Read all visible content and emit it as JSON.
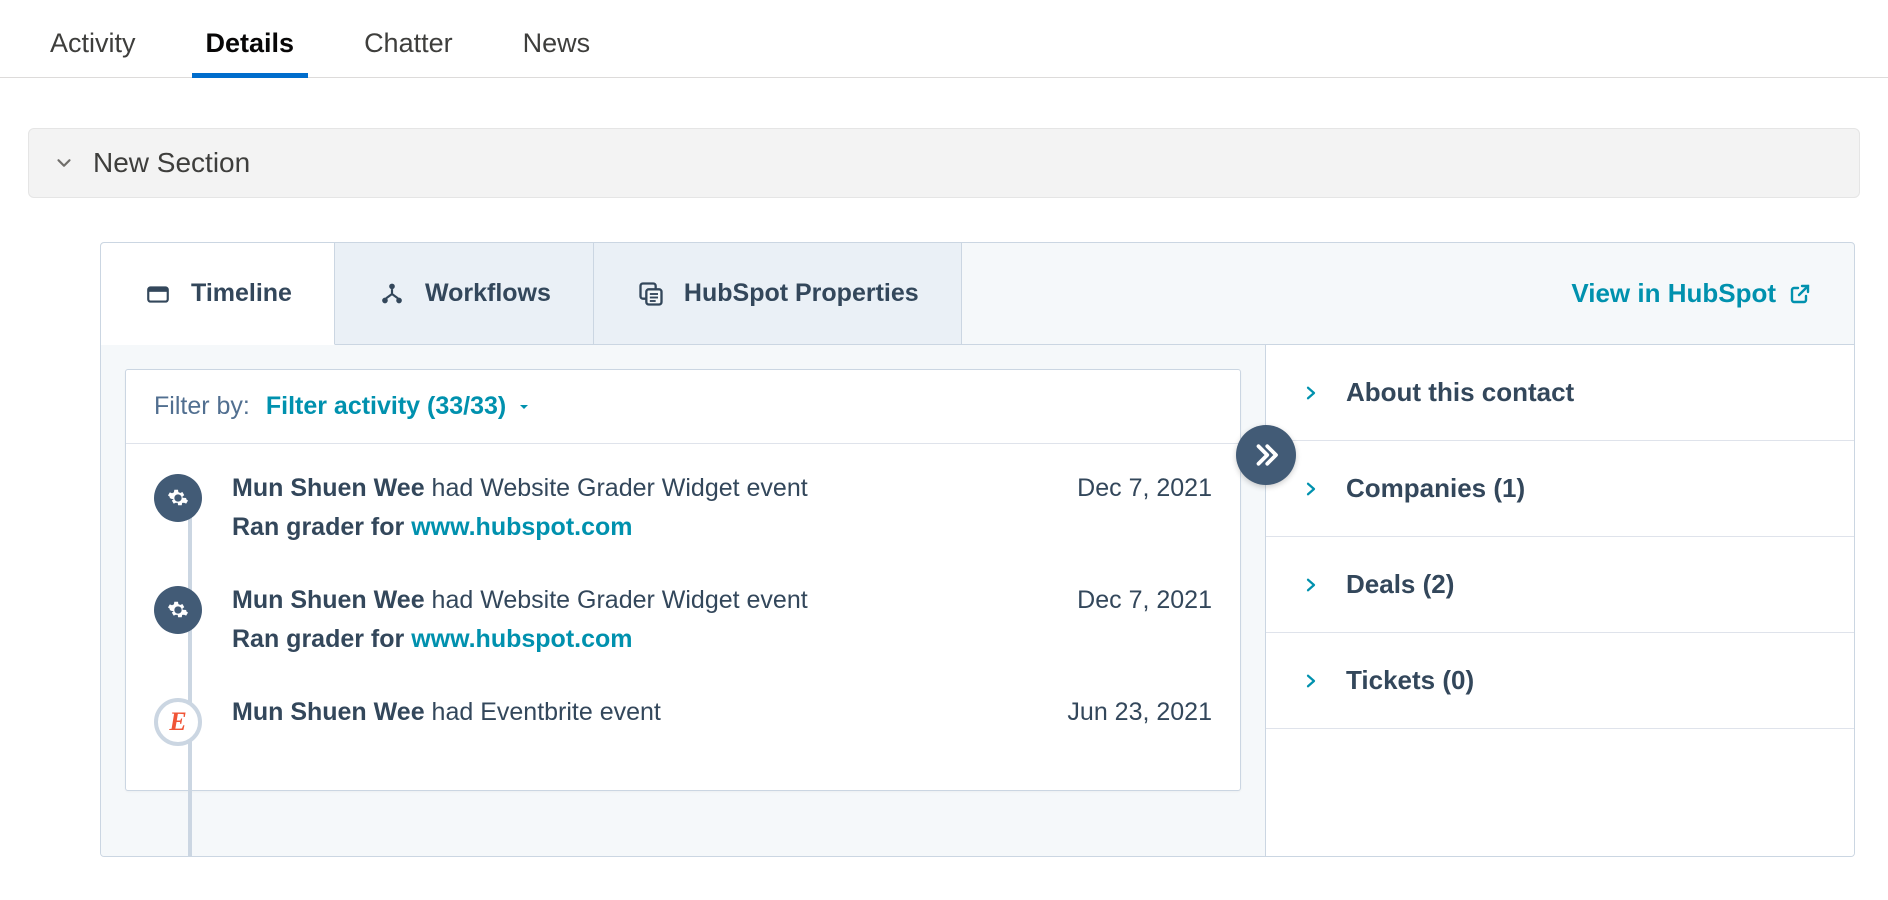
{
  "top_tabs": {
    "activity": "Activity",
    "details": "Details",
    "chatter": "Chatter",
    "news": "News"
  },
  "section": {
    "title": "New Section"
  },
  "hubspot": {
    "tabs": {
      "timeline": "Timeline",
      "workflows": "Workflows",
      "properties": "HubSpot Properties"
    },
    "view_in": "View in HubSpot",
    "filter": {
      "label": "Filter by:",
      "active": "Filter activity (33/33)"
    },
    "events": [
      {
        "actor": "Mun Shuen Wee",
        "tail": " had Website Grader Widget event",
        "date": "Dec 7, 2021",
        "line2_prefix": "Ran grader for ",
        "line2_link": "www.hubspot.com",
        "badge": "gear"
      },
      {
        "actor": "Mun Shuen Wee",
        "tail": " had Website Grader Widget event",
        "date": "Dec 7, 2021",
        "line2_prefix": "Ran grader for ",
        "line2_link": "www.hubspot.com",
        "badge": "gear"
      },
      {
        "actor": "Mun Shuen Wee",
        "tail": " had Eventbrite event",
        "date": "Jun 23, 2021",
        "line2_prefix": "",
        "line2_link": "",
        "badge": "eb"
      }
    ],
    "sidebar": [
      {
        "title": "About this contact"
      },
      {
        "title": "Companies (1)"
      },
      {
        "title": "Deals (2)"
      },
      {
        "title": "Tickets (0)"
      }
    ]
  }
}
